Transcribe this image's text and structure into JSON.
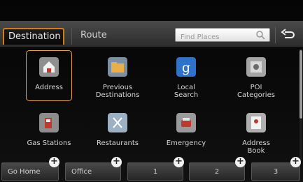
{
  "tabs": {
    "destination": "Destination",
    "route": "Route"
  },
  "search": {
    "placeholder": "Find Places"
  },
  "tiles": [
    {
      "label": "Address",
      "icon": "house-icon"
    },
    {
      "label": "Previous\nDestinations",
      "icon": "folder-flag-icon"
    },
    {
      "label": "Local\nSearch",
      "icon": "google-icon"
    },
    {
      "label": "POI\nCategories",
      "icon": "poi-icon"
    },
    {
      "label": "Gas Stations",
      "icon": "gas-pump-icon"
    },
    {
      "label": "Restaurants",
      "icon": "fork-knife-icon"
    },
    {
      "label": "Emergency",
      "icon": "emergency-light-icon"
    },
    {
      "label": "Address\nBook",
      "icon": "address-book-icon"
    }
  ],
  "quick": [
    {
      "label": "Go Home"
    },
    {
      "label": "Office"
    },
    {
      "label": "1"
    },
    {
      "label": "2"
    },
    {
      "label": "3"
    }
  ],
  "colors": {
    "accent": "#d77b12",
    "selection": "#e7a04d"
  }
}
